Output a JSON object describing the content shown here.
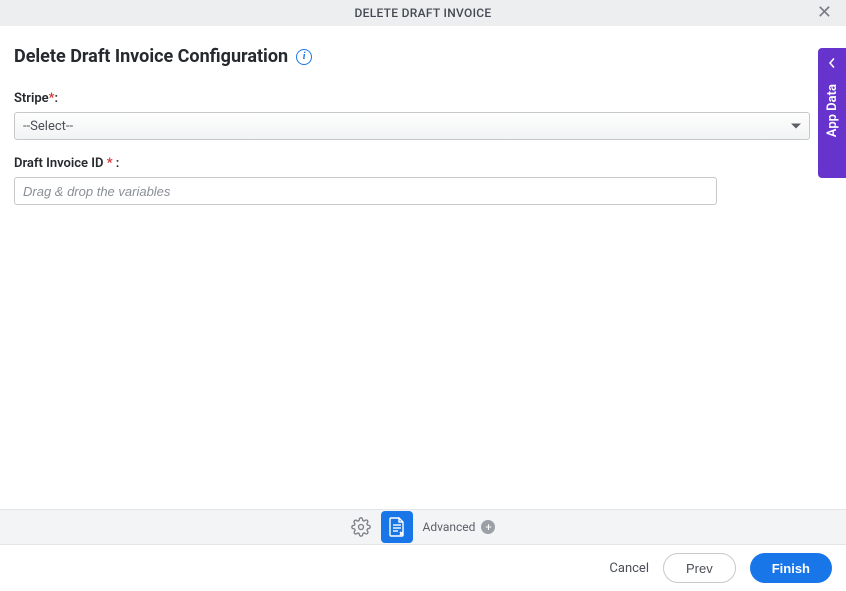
{
  "header": {
    "title": "DELETE DRAFT INVOICE"
  },
  "page": {
    "title": "Delete Draft Invoice Configuration"
  },
  "fields": {
    "stripe": {
      "label": "Stripe",
      "selected": "--Select--"
    },
    "draft_invoice_id": {
      "label": "Draft Invoice ID ",
      "placeholder": "Drag & drop the variables"
    }
  },
  "side_tab": {
    "label": "App Data"
  },
  "toolbar": {
    "advanced_label": "Advanced"
  },
  "footer": {
    "cancel": "Cancel",
    "prev": "Prev",
    "finish": "Finish"
  }
}
